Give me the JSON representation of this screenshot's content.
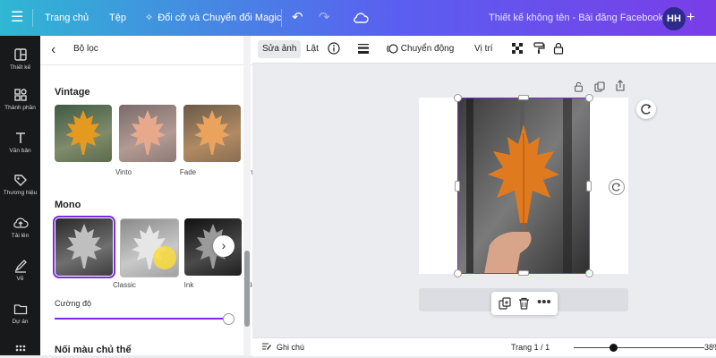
{
  "topbar": {
    "home": "Trang chủ",
    "file": "Tệp",
    "magic": "Đổi cỡ và Chuyển đổi Magic",
    "doc_title": "Thiết kế không tên - Bài đăng Facebook",
    "avatar_initials": "HH"
  },
  "rail": [
    {
      "label": "Thiết kế",
      "icon": "layout-icon"
    },
    {
      "label": "Thành phần",
      "icon": "elements-icon"
    },
    {
      "label": "Văn bản",
      "icon": "text-icon"
    },
    {
      "label": "Thương hiệu",
      "icon": "brand-icon"
    },
    {
      "label": "Tải lên",
      "icon": "upload-icon"
    },
    {
      "label": "Vẽ",
      "icon": "draw-icon"
    },
    {
      "label": "Dự án",
      "icon": "folder-icon"
    }
  ],
  "panel": {
    "title": "Bộ lọc",
    "sections": [
      {
        "title": "Vintage",
        "filters": [
          "Vinto",
          "Fade",
          "Antiq"
        ]
      },
      {
        "title": "Mono",
        "filters": [
          "Classic",
          "Ink",
          "Noir"
        ]
      }
    ],
    "intensity_label": "Cường độ",
    "intensity_value": 1.0,
    "next_section": "Nối màu chủ thể"
  },
  "toolbar": {
    "edit_photo": "Sửa ảnh",
    "flip": "Lật",
    "animate": "Chuyển động",
    "position": "Vị trí"
  },
  "bottombar": {
    "notes": "Ghi chú",
    "page": "Trang 1 / 1",
    "zoom": "38%"
  },
  "colors": {
    "accent": "#7d2ae8",
    "leaf": "#e07a1f"
  }
}
